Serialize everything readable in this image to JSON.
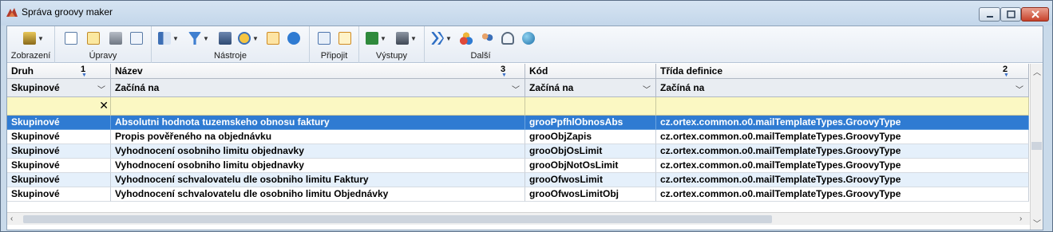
{
  "window": {
    "title": "Správa groovy maker"
  },
  "ribbon": {
    "groups": [
      {
        "label": "Zobrazení"
      },
      {
        "label": "Úpravy"
      },
      {
        "label": "Nástroje"
      },
      {
        "label": "Připojit"
      },
      {
        "label": "Výstupy"
      },
      {
        "label": "Další"
      }
    ]
  },
  "columns": [
    {
      "header": "Druh",
      "sort_order": "1",
      "filter": "Skupinové"
    },
    {
      "header": "Název",
      "sort_order": "3",
      "filter": "Začíná na"
    },
    {
      "header": "Kód",
      "sort_order": "",
      "filter": "Začíná na"
    },
    {
      "header": "Třída definice",
      "sort_order": "2",
      "filter": "Začíná na"
    }
  ],
  "rows": [
    {
      "druh": "Skupinové",
      "nazev": "Absolutni hodnota tuzemskeho obnosu faktury",
      "kod": "grooPpfhlObnosAbs",
      "trida": "cz.ortex.common.o0.mailTemplateTypes.GroovyType",
      "selected": true
    },
    {
      "druh": "Skupinové",
      "nazev": "Propis pověřeného na objednávku",
      "kod": "grooObjZapis",
      "trida": "cz.ortex.common.o0.mailTemplateTypes.GroovyType",
      "selected": false
    },
    {
      "druh": "Skupinové",
      "nazev": "Vyhodnocení osobniho limitu objednavky",
      "kod": "grooObjOsLimit",
      "trida": "cz.ortex.common.o0.mailTemplateTypes.GroovyType",
      "selected": false
    },
    {
      "druh": "Skupinové",
      "nazev": "Vyhodnocení osobniho limitu objednavky",
      "kod": "grooObjNotOsLimit",
      "trida": "cz.ortex.common.o0.mailTemplateTypes.GroovyType",
      "selected": false
    },
    {
      "druh": "Skupinové",
      "nazev": "Vyhodnocení schvalovatelu dle osobniho limitu Faktury",
      "kod": "grooOfwosLimit",
      "trida": "cz.ortex.common.o0.mailTemplateTypes.GroovyType",
      "selected": false
    },
    {
      "druh": "Skupinové",
      "nazev": "Vyhodnocení schvalovatelu dle osobniho limitu Objednávky",
      "kod": "grooOfwosLimitObj",
      "trida": "cz.ortex.common.o0.mailTemplateTypes.GroovyType",
      "selected": false
    }
  ],
  "filter_clear_icon": "close-icon"
}
